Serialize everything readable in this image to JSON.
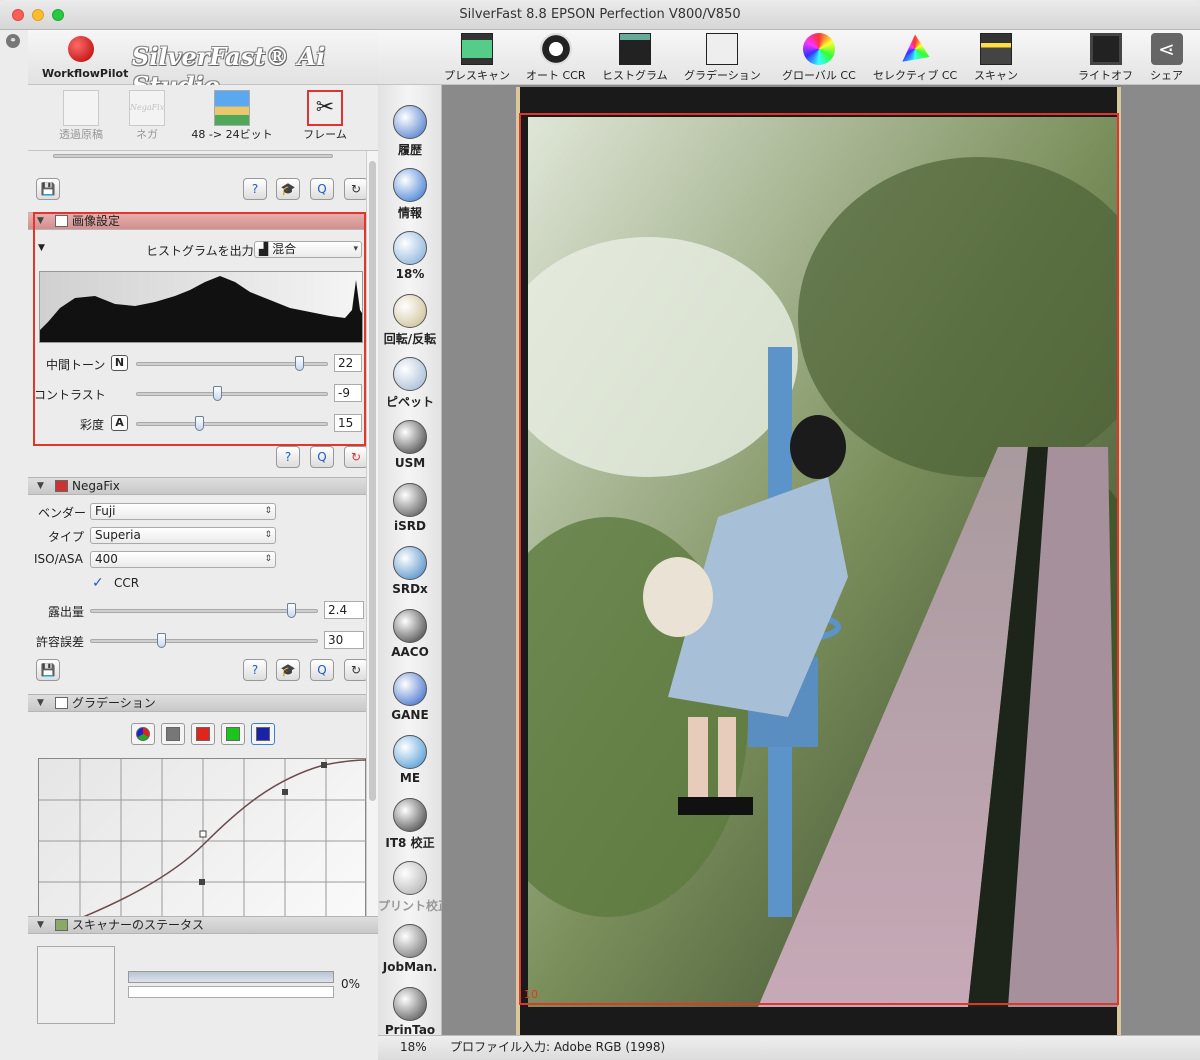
{
  "window": {
    "title": "SilverFast 8.8 EPSON Perfection V800/V850"
  },
  "header": {
    "workflow_label": "WorkflowPilot",
    "brand": "SilverFast® Ai Studio"
  },
  "modes": [
    {
      "label": "透過原稿"
    },
    {
      "label": "ネガ"
    },
    {
      "label": "48 -> 24ビット"
    },
    {
      "label": "フレーム"
    }
  ],
  "mode_icon_text": "NegaFix",
  "image_settings": {
    "title": "画像設定",
    "hist_output_label": "ヒストグラムを出力",
    "hist_output_value": "混合",
    "sliders": [
      {
        "label": "中間トーン",
        "tag": "N",
        "value": "22",
        "level": 0.85
      },
      {
        "label": "コントラスト",
        "tag": "",
        "value": "-9",
        "level": 0.42
      },
      {
        "label": "彩度",
        "tag": "A",
        "value": "15",
        "level": 0.33
      }
    ]
  },
  "negafix": {
    "title": "NegaFix",
    "vendor_label": "ベンダー",
    "vendor_value": "Fuji",
    "type_label": "タイプ",
    "type_value": "Superia",
    "iso_label": "ISO/ASA",
    "iso_value": "400",
    "ccr_label": "CCR",
    "ccr_checked": true,
    "exposure_label": "露出量",
    "exposure_value": "2.4",
    "exposure_level": 0.88,
    "tolerance_label": "許容誤差",
    "tolerance_value": "30",
    "tolerance_level": 0.31
  },
  "gradation": {
    "title": "グラデーション"
  },
  "scanner_status": {
    "title": "スキャナーのステータス",
    "percent": "0%",
    "progress": 0
  },
  "toolbar": [
    {
      "label": "プレスキャン",
      "icon": "prescan-icon"
    },
    {
      "label": "オート CCR",
      "icon": "auto-ccr-icon"
    },
    {
      "label": "ヒストグラム",
      "icon": "histogram-icon"
    },
    {
      "label": "グラデーション",
      "icon": "gradation-icon"
    },
    {
      "label": "グローバル CC",
      "icon": "global-cc-icon"
    },
    {
      "label": "セレクティブ CC",
      "icon": "selective-cc-icon"
    },
    {
      "label": "スキャン",
      "icon": "scan-icon"
    },
    {
      "label": "ライトオフ",
      "icon": "light-off-icon"
    },
    {
      "label": "シェア",
      "icon": "share-icon"
    }
  ],
  "tools": [
    {
      "label": "履歴",
      "icon": "history-icon"
    },
    {
      "label": "情報",
      "icon": "info-icon"
    },
    {
      "label": "18%",
      "icon": "zoom-icon"
    },
    {
      "label": "回転/反転",
      "icon": "rotate-flip-icon"
    },
    {
      "label": "ピペット",
      "icon": "pipette-icon"
    },
    {
      "label": "USM",
      "icon": "usm-icon"
    },
    {
      "label": "iSRD",
      "icon": "isrd-icon"
    },
    {
      "label": "SRDx",
      "icon": "srdx-icon"
    },
    {
      "label": "AACO",
      "icon": "aaco-icon"
    },
    {
      "label": "GANE",
      "icon": "gane-icon"
    },
    {
      "label": "ME",
      "icon": "me-icon"
    },
    {
      "label": "IT8 校正",
      "icon": "it8-icon"
    },
    {
      "label": "プリント校正",
      "icon": "print-calibration-icon"
    },
    {
      "label": "JobMan.",
      "icon": "jobman-icon"
    },
    {
      "label": "PrinTao",
      "icon": "printao-icon"
    }
  ],
  "preview": {
    "frame_number": "10"
  },
  "statusbar": {
    "zoom": "18%",
    "profile": "プロファイル入力: Adobe RGB (1998)"
  },
  "colors": {
    "accent_red": "#e0372c",
    "header_pink": "#d38e8e"
  }
}
